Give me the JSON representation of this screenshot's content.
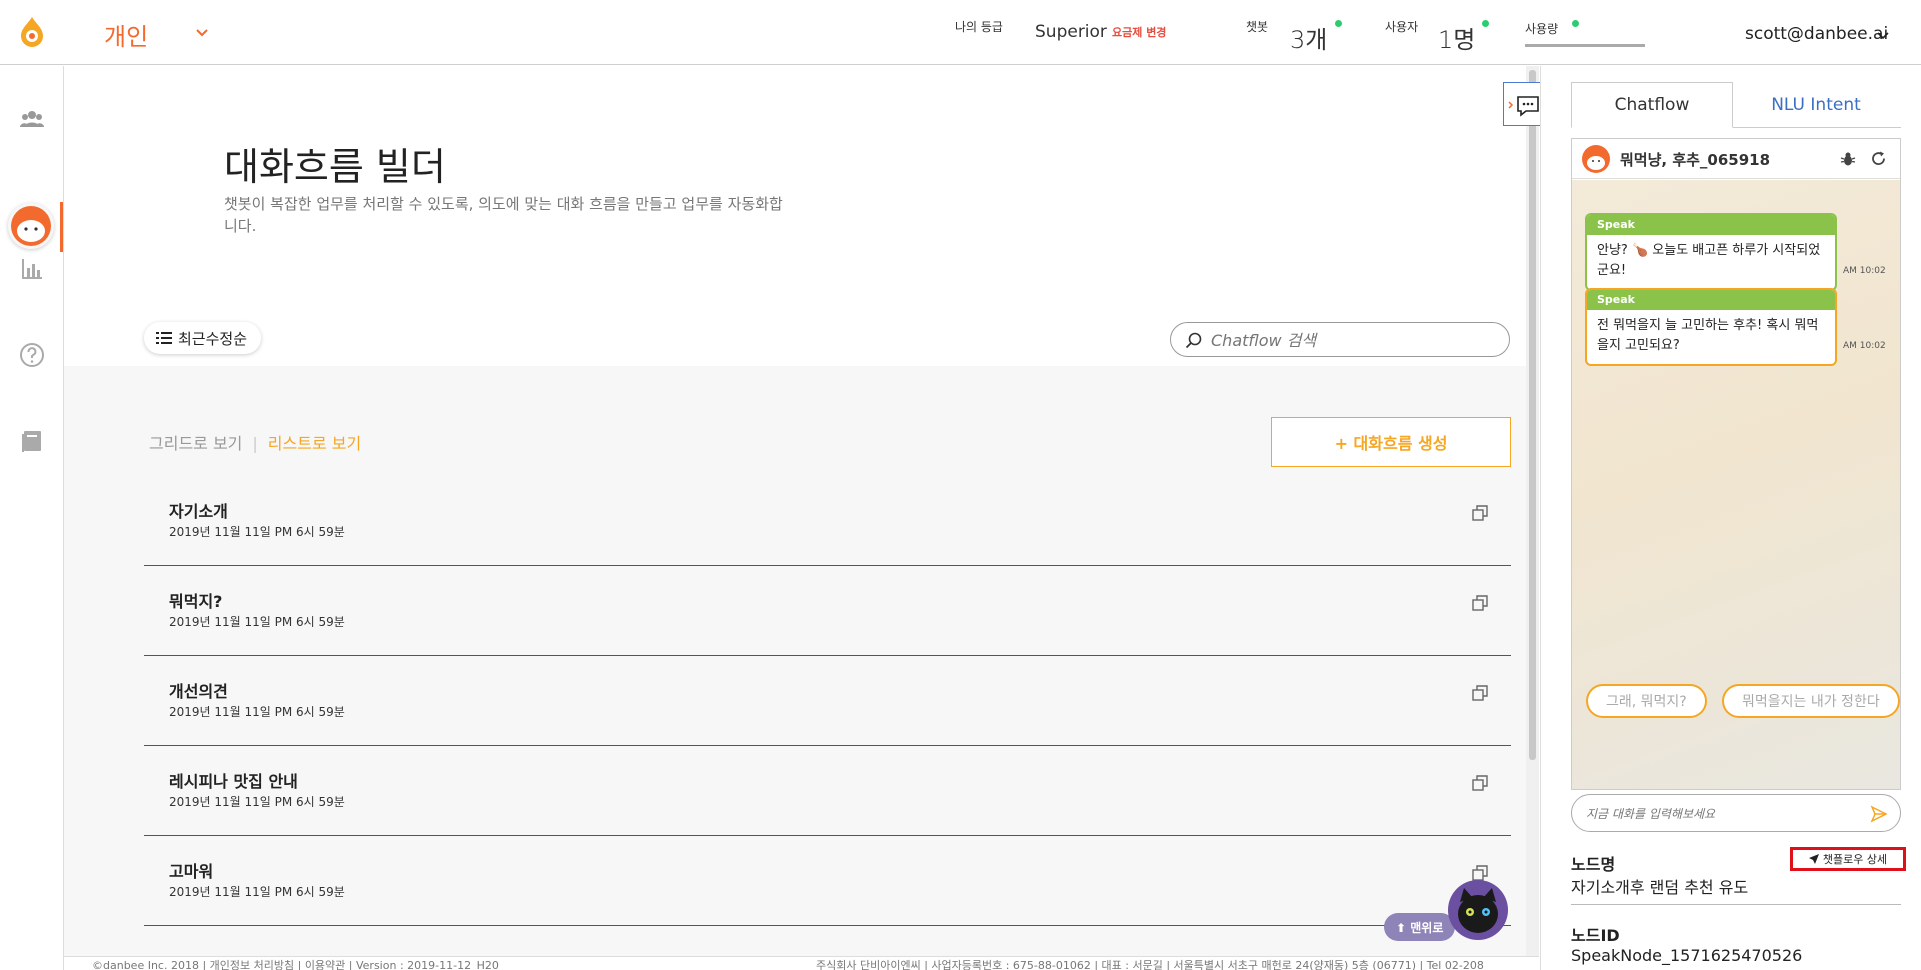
{
  "header": {
    "workspace": "개인",
    "grade_label": "나의 등급",
    "grade_value": "Superior",
    "grade_change": "요금제 변경",
    "chatbot_label": "챗봇",
    "chatbot_value": "3개",
    "user_label": "사용자",
    "user_value": "1명",
    "usage_label": "사용량",
    "user_email": "scott@danbee.ai",
    "status_color": "#2ecc71",
    "accent_color": "#f26a2e"
  },
  "main": {
    "title": "대화흐름 빌더",
    "description": "챗봇이 복잡한 업무를 처리할 수 있도록, 의도에 맞는 대화 흐름을 만들고 업무를 자동화합니다.",
    "sort_label": "최근수정순",
    "search_placeholder": "Chatflow 검색",
    "view_grid": "그리드로 보기",
    "view_separator": "|",
    "view_list": "리스트로 보기",
    "create_label": "+ 대화흐름 생성",
    "flows": [
      {
        "name": "자기소개",
        "date": "2019년 11월 11일 PM 6시 59분"
      },
      {
        "name": "뭐먹지?",
        "date": "2019년 11월 11일 PM 6시 59분"
      },
      {
        "name": "개선의견",
        "date": "2019년 11월 11일 PM 6시 59분"
      },
      {
        "name": "레시피나 맛집 안내",
        "date": "2019년 11월 11일 PM 6시 59분"
      },
      {
        "name": "고마워",
        "date": "2019년 11월 11일 PM 6시 59분"
      }
    ]
  },
  "footer": {
    "left": "©danbee Inc. 2018 | 개인정보 처리방침 | 이용약관 | Version : 2019-11-12_H20",
    "right": "주식회사 단비아이엔씨 | 사업자등록번호 : 675-88-01062 | 대표 : 서문길 | 서울특별시 서초구 매헌로 24(양재동) 5층 (06771) | Tel 02-208"
  },
  "widgets": {
    "back_to_top": "⬆ 맨위로"
  },
  "right_panel": {
    "tabs": [
      {
        "label": "Chatflow"
      },
      {
        "label": "NLU Intent"
      }
    ],
    "bot_name": "뭐먹냥, 후추_065918",
    "messages": [
      {
        "head": "Speak",
        "text": "안냥? 🍗 오늘도 배고픈 하루가 시작되었군요!",
        "time": "AM 10:02"
      },
      {
        "head": "Speak",
        "text": "전 뭐먹을지 늘 고민하는 후추! 혹시 뭐먹을지 고민되요?",
        "time": "AM 10:02"
      }
    ],
    "quick_replies": [
      "그래, 뭐먹지?",
      "뭐먹을지는 내가 정한다"
    ],
    "input_placeholder": "지금 대화를 입력해보세요",
    "node_name_label": "노드명",
    "detail_label": "챗플로우 상세",
    "node_name_value": "자기소개후 랜덤 추천 유도",
    "node_id_label": "노드ID",
    "node_id_value": "SpeakNode_1571625470526"
  }
}
